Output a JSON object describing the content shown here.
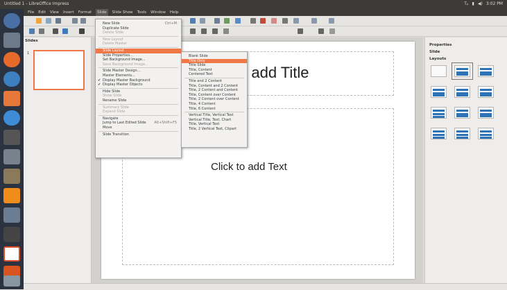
{
  "window": {
    "title": "Untitled 1 - LibreOffice Impress",
    "tray": [
      "Tₚ",
      "▮",
      "◀)",
      "3:02 PM"
    ]
  },
  "menubar": [
    "File",
    "Edit",
    "View",
    "Insert",
    "Format",
    "Slide",
    "Slide Show",
    "Tools",
    "Window",
    "Help"
  ],
  "slides_pane": {
    "header": "Slides",
    "slide_number": "1"
  },
  "slide": {
    "title_placeholder": "o add Title",
    "text_placeholder": "Click to add Text"
  },
  "properties": {
    "header": "Properties",
    "slide_section": "Slide",
    "layouts_section": "Layouts"
  },
  "slide_menu": [
    {
      "label": "New Slide",
      "shortcut": "Ctrl+M",
      "disabled": false
    },
    {
      "label": "Duplicate Slide",
      "disabled": false
    },
    {
      "label": "Delete Slide",
      "disabled": true
    },
    {
      "sep": true
    },
    {
      "label": "New Layout",
      "disabled": true
    },
    {
      "label": "Delete Master",
      "disabled": true
    },
    {
      "sep": true
    },
    {
      "label": "Slide Layout",
      "highlighted": true
    },
    {
      "label": "Slide Properties...",
      "disabled": false
    },
    {
      "label": "Set Background Image...",
      "disabled": false
    },
    {
      "label": "Save Background Image...",
      "disabled": true
    },
    {
      "sep": true
    },
    {
      "label": "Slide Master Design...",
      "disabled": false
    },
    {
      "label": "Master Elements...",
      "disabled": false
    },
    {
      "label": "Display Master Background",
      "checked": true
    },
    {
      "label": "Display Master Objects",
      "checked": true
    },
    {
      "sep": true
    },
    {
      "label": "Hide Slide",
      "disabled": false
    },
    {
      "label": "Show Slide",
      "disabled": true
    },
    {
      "label": "Rename Slide",
      "disabled": false
    },
    {
      "sep": true
    },
    {
      "label": "Summary Slide",
      "disabled": true
    },
    {
      "label": "Expand Slide",
      "disabled": true
    },
    {
      "sep": true
    },
    {
      "label": "Navigate",
      "disabled": false
    },
    {
      "label": "Jump to Last Edited Slide",
      "shortcut": "Alt+Shift+F5",
      "disabled": false
    },
    {
      "label": "Move",
      "disabled": false
    },
    {
      "sep": true
    },
    {
      "label": "Slide Transition",
      "disabled": false
    }
  ],
  "layout_submenu": [
    {
      "label": "Blank Slide"
    },
    {
      "label": "Title Only",
      "highlighted": true
    },
    {
      "label": "Title Slide"
    },
    {
      "label": "Title, Content"
    },
    {
      "label": "Centered Text"
    },
    {
      "sep": true
    },
    {
      "label": "Title and 2 Content"
    },
    {
      "label": "Title, Content and 2 Content"
    },
    {
      "label": "Title, 2 Content and Content"
    },
    {
      "label": "Title, Content over Content"
    },
    {
      "label": "Title, 2 Content over Content"
    },
    {
      "label": "Title, 4 Content"
    },
    {
      "label": "Title, 6 Content"
    },
    {
      "sep": true
    },
    {
      "label": "Vertical Title, Vertical Text"
    },
    {
      "label": "Vertical Title, Text, Chart"
    },
    {
      "label": "Title, Vertical Text"
    },
    {
      "label": "Title, 2 Vertical Text, Clipart"
    }
  ],
  "colors": {
    "highlight": "#f07746",
    "launcher": "#2b3340",
    "layout_blue": "#2d73b5"
  }
}
